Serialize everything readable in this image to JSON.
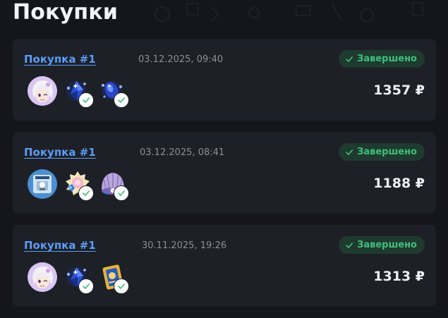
{
  "page": {
    "title": "Покупки"
  },
  "status_color": "#3fc07d",
  "link_color": "#5b9df5",
  "purchases": [
    {
      "title": "Покупка #1",
      "date": "03.12.2025, 09:40",
      "status": "Завершено",
      "price": "1357 ₽",
      "items": [
        "character-avatar-icon",
        "blue-crystal-icon",
        "blue-orb-icon"
      ]
    },
    {
      "title": "Покупка #1",
      "date": "03.12.2025, 08:41",
      "status": "Завершено",
      "price": "1188 ₽",
      "items": [
        "pass-card-icon",
        "flower-gem-icon",
        "seashell-icon"
      ]
    },
    {
      "title": "Покупка #1",
      "date": "30.11.2025, 19:26",
      "status": "Завершено",
      "price": "1313 ₽",
      "items": [
        "character-avatar-icon",
        "blue-crystal-icon",
        "golden-card-icon"
      ]
    }
  ]
}
